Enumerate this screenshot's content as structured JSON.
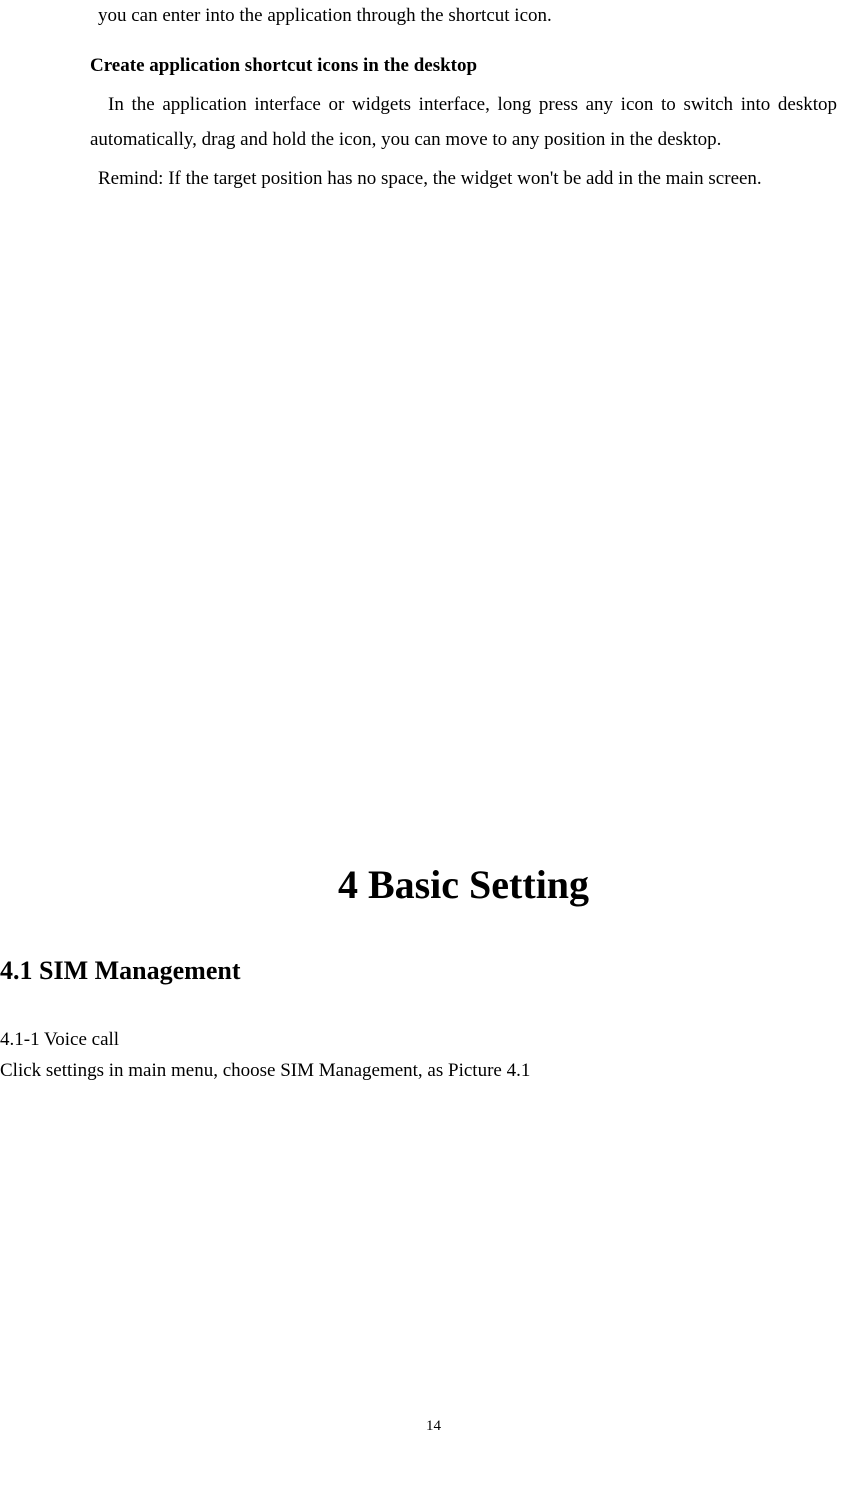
{
  "content": {
    "para1": "you can enter into the application through the shortcut icon.",
    "heading1": "Create application shortcut icons in the desktop",
    "para2": "In the application interface or widgets interface, long press any icon to switch into desktop automatically, drag and hold the icon, you can move to any position in the desktop.",
    "para3": "Remind: If the target position has no space, the widget won't be add in the main screen.",
    "chapter": "4 Basic Setting",
    "section": "4.1 SIM Management",
    "subsection": "4.1-1 Voice call",
    "subsection_desc": "Click settings in main menu, choose SIM Management, as Picture 4.1"
  },
  "page_number": "14"
}
